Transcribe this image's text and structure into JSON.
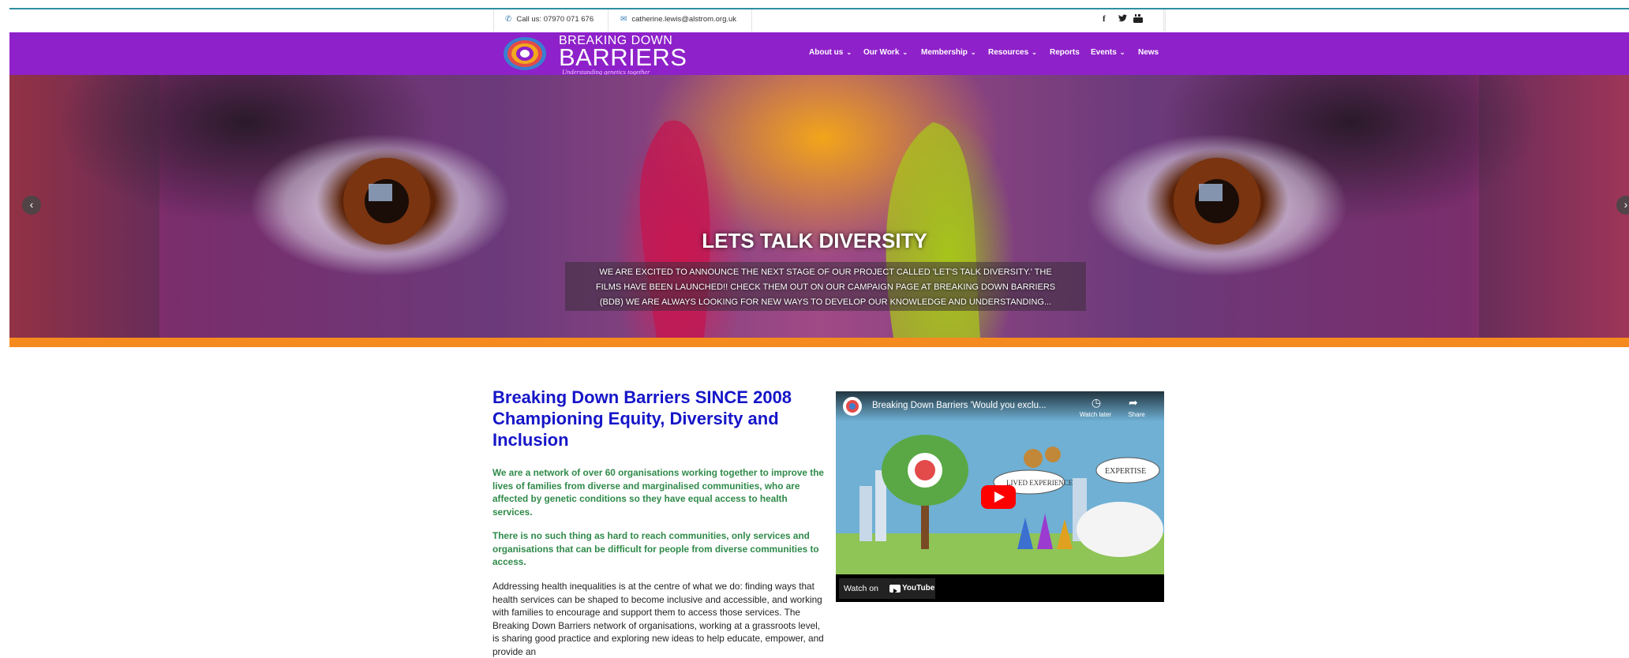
{
  "contact": {
    "phone": "Call us: 07970 071 676",
    "email": "catherine.lewis@alstrom.org.uk"
  },
  "social": [
    "facebook-icon",
    "twitter-icon",
    "youtube-icon"
  ],
  "logo": {
    "top": "BREAKING DOWN",
    "main": "BARRIERS",
    "tagline": "Understanding genetics together"
  },
  "nav": [
    {
      "label": "About us",
      "dropdown": true
    },
    {
      "label": "Our Work",
      "dropdown": true
    },
    {
      "label": "Membership",
      "dropdown": true
    },
    {
      "label": "Resources",
      "dropdown": true
    },
    {
      "label": "Reports",
      "dropdown": false
    },
    {
      "label": "Events",
      "dropdown": true
    },
    {
      "label": "News",
      "dropdown": false
    }
  ],
  "hero": {
    "title": "LETS TALK DIVERSITY",
    "lines": [
      "WE ARE EXCITED TO ANNOUNCE THE NEXT STAGE OF OUR PROJECT CALLED 'LET'S TALK DIVERSITY.' THE",
      "FILMS HAVE BEEN LAUNCHED!! CHECK THEM OUT ON OUR CAMPAIGN PAGE AT BREAKING DOWN BARRIERS",
      "(BDB) WE ARE ALWAYS LOOKING FOR NEW WAYS TO DEVELOP OUR KNOWLEDGE AND UNDERSTANDING..."
    ]
  },
  "main": {
    "headline": "Breaking Down Barriers SINCE 2008 Championing Equity, Diversity and Inclusion",
    "para1": "We are a network of over 60 organisations working together to improve the lives of families from diverse and marginalised communities, who are affected by genetic conditions so they have equal access to health services.",
    "para2": "There is no such thing as hard to reach communities, only services and organisations that can be difficult for people from diverse communities to access.",
    "para3": "Addressing health inequalities is at the centre of what we do: finding ways that health services can be shaped to become inclusive and accessible, and working with families to encourage and support them to access those services. The Breaking Down Barriers network of organisations, working at a grassroots level, is sharing good practice and exploring new ideas to help educate, empower, and provide an"
  },
  "video": {
    "title": "Breaking Down Barriers 'Would you exclu...",
    "watch_later": "Watch later",
    "share": "Share",
    "watch_on": "Watch on",
    "youtube": "YouTube",
    "label_lived": "LIVED EXPERIENCE",
    "label_expertise": "EXPERTISE"
  }
}
